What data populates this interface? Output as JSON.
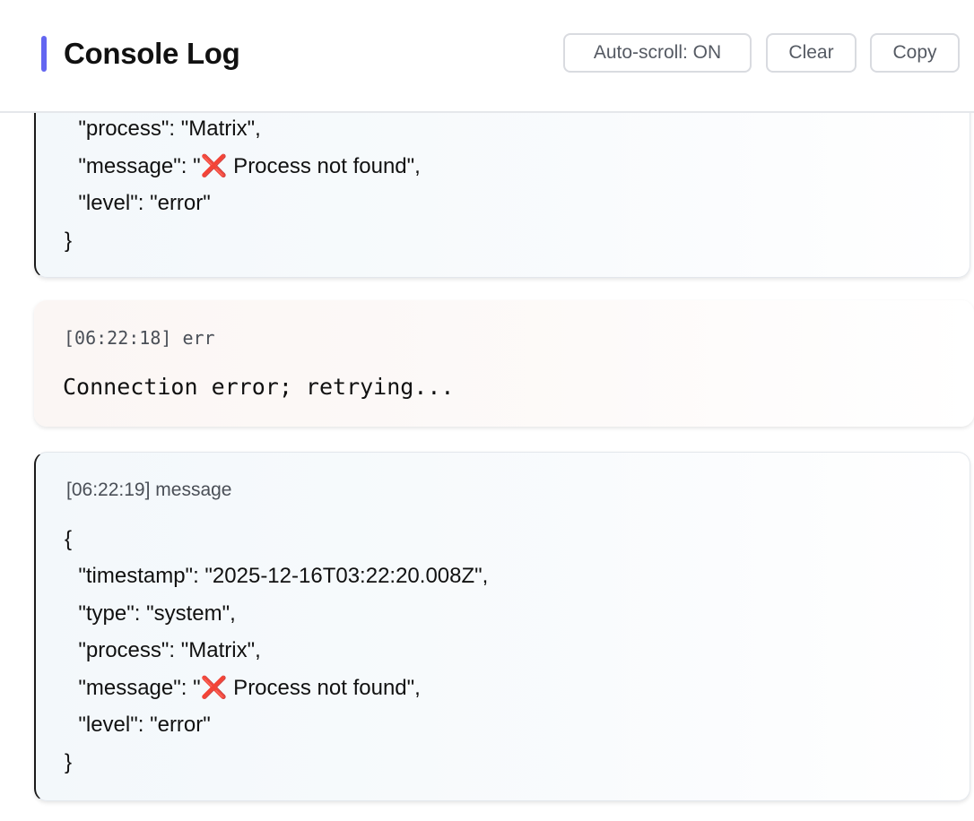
{
  "header": {
    "title": "Console Log",
    "accent_color": "#6366f1",
    "buttons": {
      "autoscroll_label": "Auto-scroll: ON",
      "clear_label": "Clear",
      "copy_label": "Copy"
    }
  },
  "entries": [
    {
      "kind": "json",
      "lines": {
        "process": "  \"process\": \"Matrix\",",
        "message_prefix": "  \"message\": \"",
        "message_icon": "❌",
        "message_suffix": " Process not found\",",
        "level": "  \"level\": \"error\"",
        "close": "}"
      }
    },
    {
      "kind": "err",
      "time": "[06:22:18]",
      "type": "err",
      "text": "Connection error; retrying..."
    },
    {
      "kind": "json",
      "time": "[06:22:19]",
      "type": "message",
      "lines": {
        "open": "{",
        "timestamp": "  \"timestamp\": \"2025-12-16T03:22:20.008Z\",",
        "type": "  \"type\": \"system\",",
        "process": "  \"process\": \"Matrix\",",
        "message_prefix": "  \"message\": \"",
        "message_icon": "❌",
        "message_suffix": " Process not found\",",
        "level": "  \"level\": \"error\"",
        "close": "}"
      }
    }
  ],
  "colors": {
    "error_icon": "#e23b2e",
    "json_card_bg": "#f3f8fb",
    "err_card_bg": "#fbf6f4"
  }
}
